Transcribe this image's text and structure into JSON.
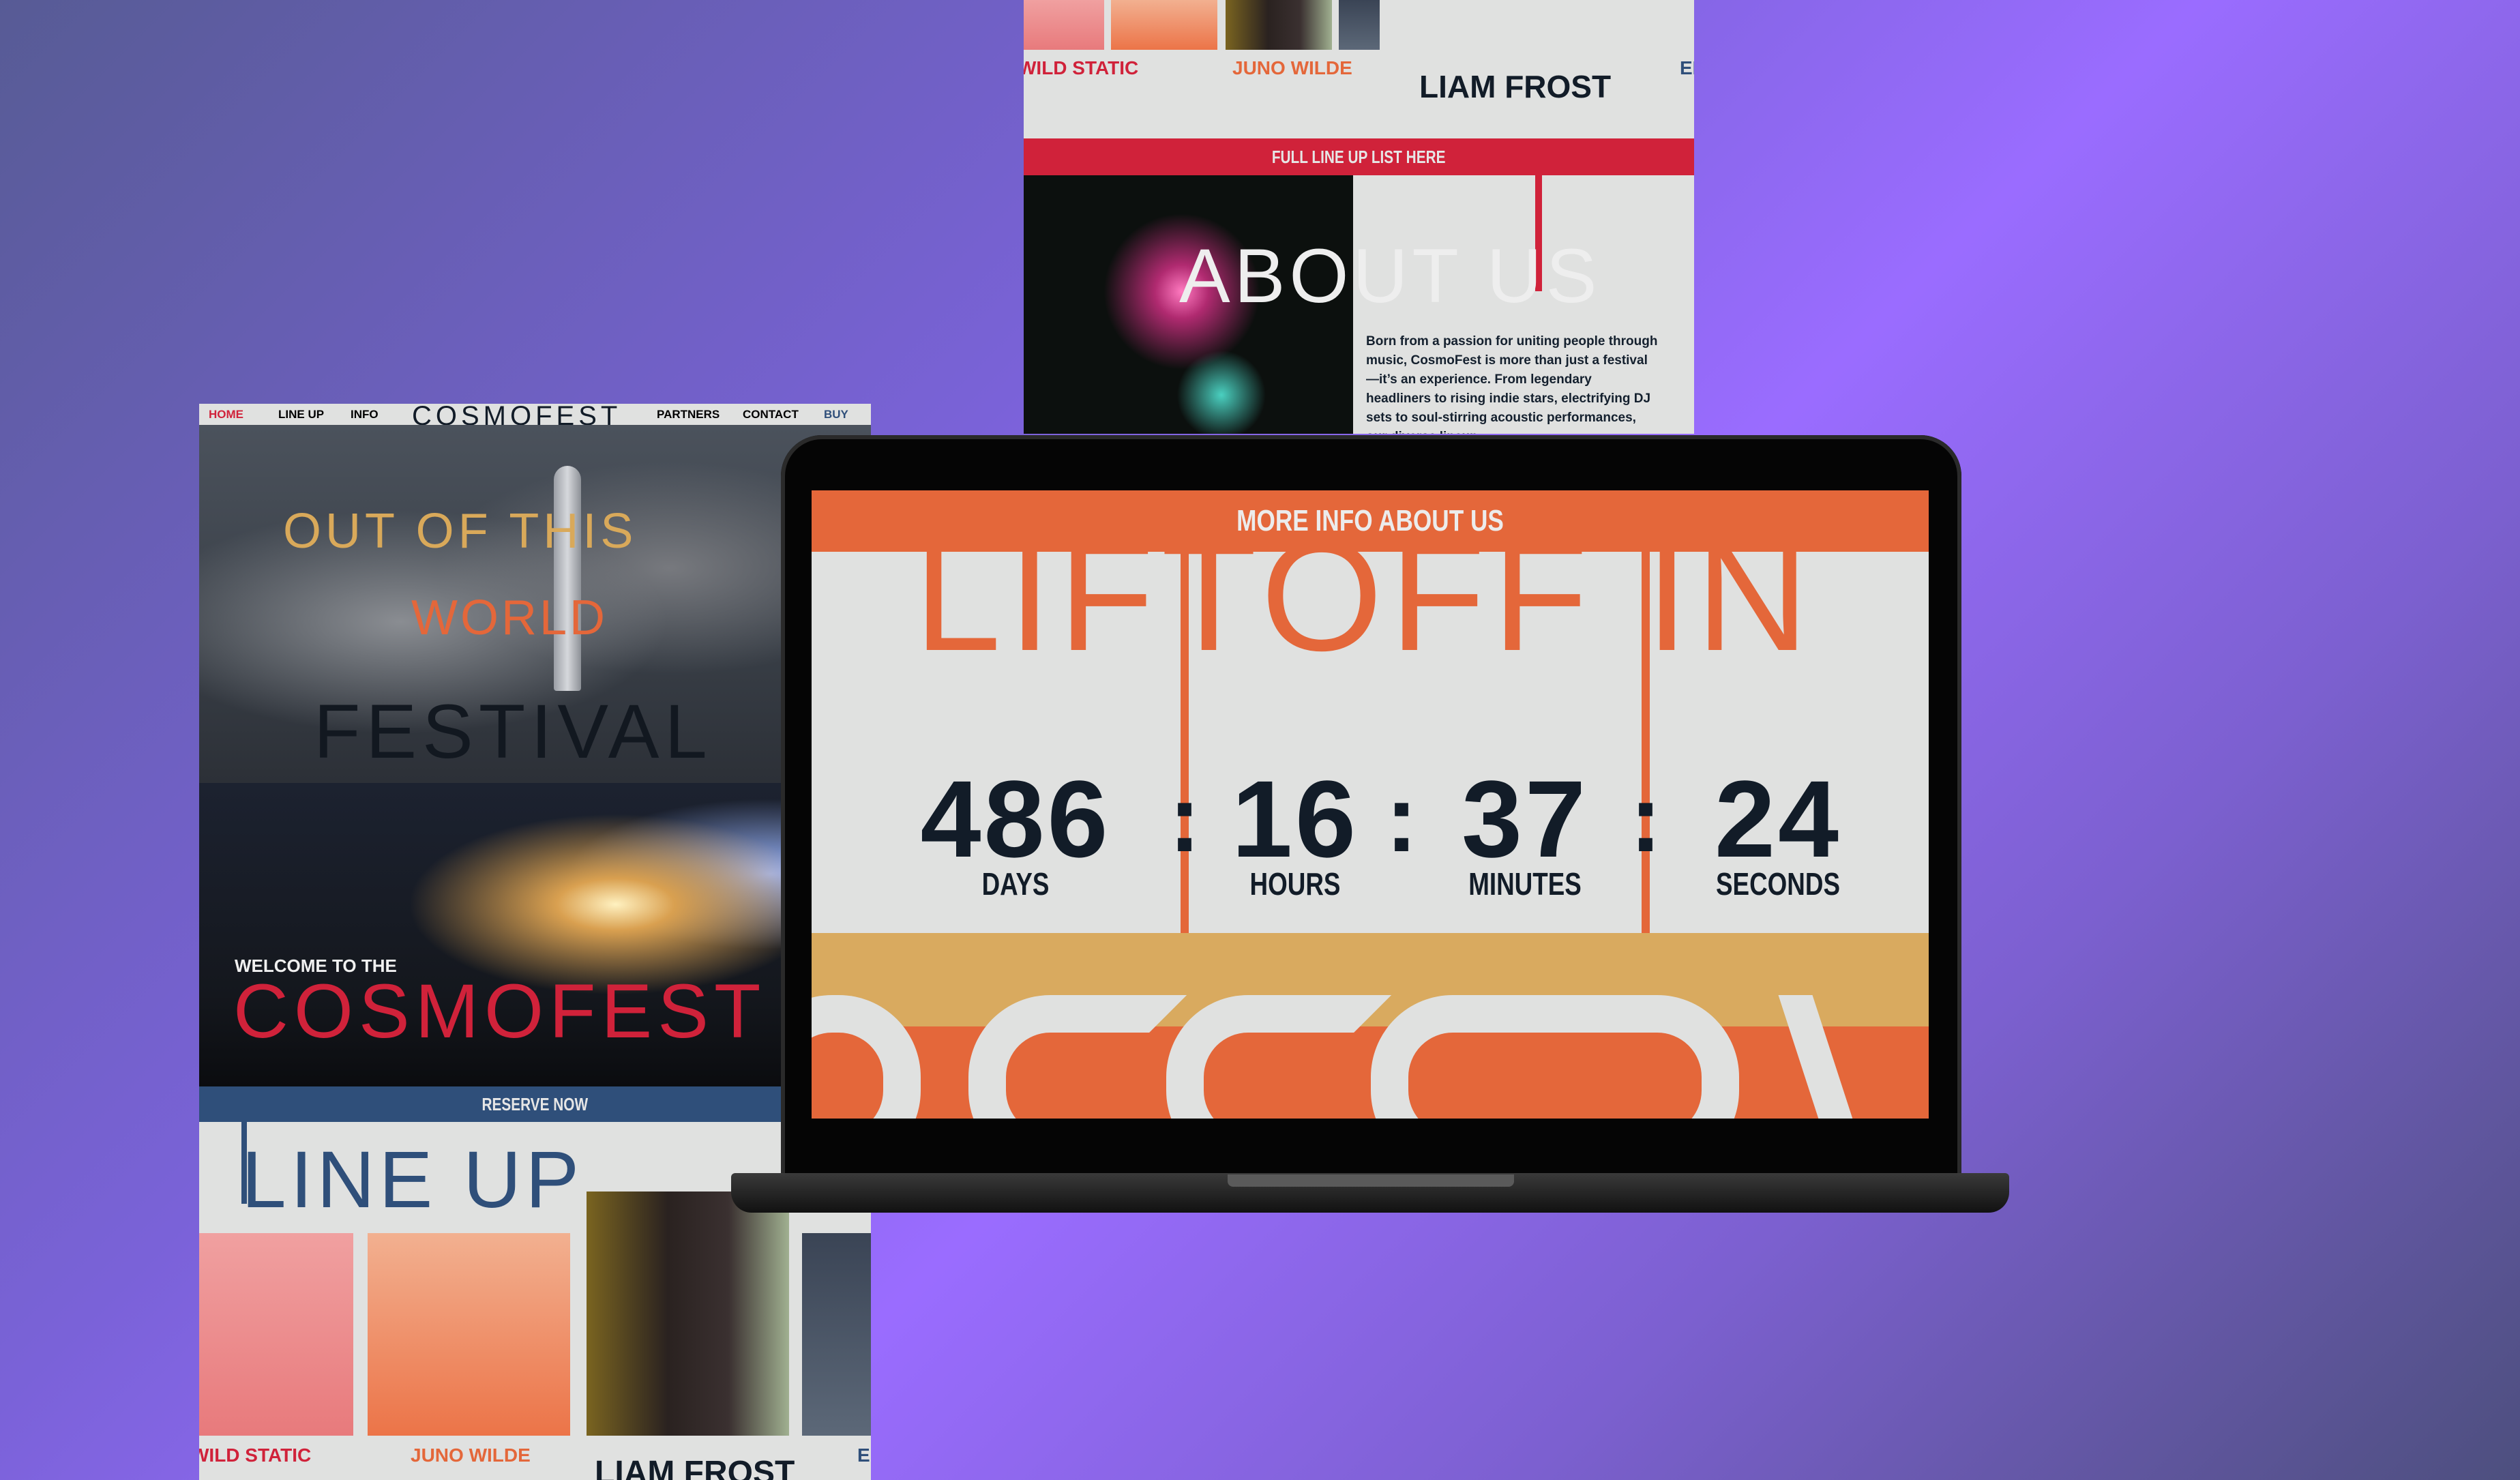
{
  "left_page": {
    "nav": {
      "home": "HOME",
      "lineup": "LINE UP",
      "info": "INFO",
      "logo": "COSMOFEST",
      "partners": "PARTNERS",
      "contact": "CONTACT",
      "buy": "BUY"
    },
    "hero": {
      "line1": "OUT OF THIS",
      "line2": "WORLD",
      "line3": "FESTIVAL"
    },
    "welcome": {
      "pre": "WELCOME TO THE",
      "name": "COSMOFEST"
    },
    "reserve": "RESERVE NOW",
    "lineup_title": "LINE UP",
    "artists": [
      "WILD STATIC",
      "JUNO WILDE",
      "LIAM FROST",
      "EI"
    ]
  },
  "top_page": {
    "artists": [
      "WILD STATIC",
      "JUNO WILDE",
      "LIAM FROST",
      "EI"
    ],
    "full_lineup": "FULL LINE UP LIST HERE",
    "about_title": "ABOUT US",
    "about_text": "Born from a passion for uniting people through music, CosmoFest is more than just a festival—it’s an experience. From legendary headliners to rising indie stars, electrifying DJ sets to soul-stirring acoustic performances, our diverse lineup"
  },
  "laptop": {
    "more_info": "MORE INFO ABOUT US",
    "heading": "LIFTOFF IN",
    "countdown": [
      {
        "value": "486",
        "label": "DAYS"
      },
      {
        "value": "16",
        "label": "HOURS"
      },
      {
        "value": "37",
        "label": "MINUTES"
      },
      {
        "value": "24",
        "label": "SECONDS"
      }
    ],
    "separator": ":"
  },
  "colors": {
    "red": "#d0223a",
    "orange": "#e4673a",
    "gold": "#d9a95a",
    "navy": "#2f4f7a",
    "dark": "#121c28",
    "light": "#e0e1e0"
  }
}
